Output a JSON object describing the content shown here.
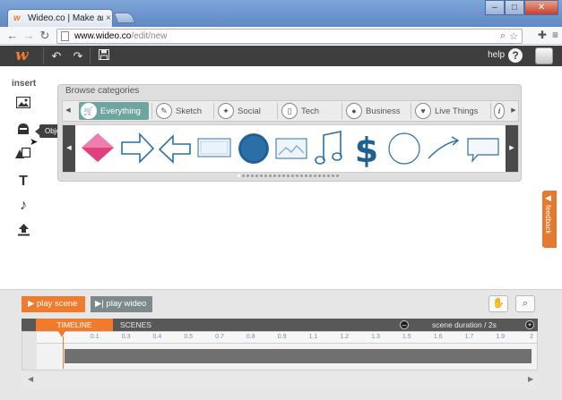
{
  "browser": {
    "tab_title": "Wideo.co | Make animated",
    "tab_close": "×",
    "favicon": "w",
    "url_host": "www.wideo.co",
    "url_path": "/edit/new",
    "window_controls": [
      "–",
      "□",
      "✕"
    ]
  },
  "app": {
    "logo": "w",
    "help_label": "help",
    "help_icon": "?"
  },
  "insert": {
    "label": "insert",
    "tools": [
      "image-icon",
      "objects-icon",
      "shapes-icon",
      "text-icon",
      "music-icon",
      "upload-icon"
    ],
    "tooltip": "Objects"
  },
  "browse": {
    "title": "Browse categories",
    "categories": [
      {
        "label": "Everything",
        "icon": "basket-icon",
        "active": true
      },
      {
        "label": "Sketch",
        "icon": "pencil-icon",
        "active": false
      },
      {
        "label": "Social",
        "icon": "twitter-icon",
        "active": false
      },
      {
        "label": "Tech",
        "icon": "phone-icon",
        "active": false
      },
      {
        "label": "Business",
        "icon": "piggy-bank-icon",
        "active": false
      },
      {
        "label": "Live Things",
        "icon": "heart-icon",
        "active": false
      },
      {
        "label": "",
        "icon": "info-icon",
        "active": false
      }
    ],
    "objects": [
      "pink-diamond",
      "right-arrow",
      "left-arrow",
      "screen",
      "blue-circle",
      "picture-frame",
      "music-note",
      "dollar-sign",
      "outline-circle",
      "curved-arrow",
      "speech-bubble"
    ],
    "page_count": 23,
    "active_page": 0
  },
  "feedback": {
    "label": "feedback"
  },
  "timeline": {
    "play_scene": "play scene",
    "play_video": "play wideo",
    "tab_timeline": "TIMELINE",
    "tab_scenes": "SCENES",
    "scene_duration": "scene duration / 2s",
    "ticks": [
      "0.1",
      "0.3",
      "0.4",
      "0.5",
      "0.7",
      "0.8",
      "0.9",
      "1.1",
      "1.2",
      "1.3",
      "1.5",
      "1.6",
      "1.7",
      "1.9",
      "2"
    ],
    "playhead_time": 0
  },
  "colors": {
    "accent": "#f07b2c",
    "app_bar": "#3e3e3e",
    "active_category": "#6fa5a0",
    "object_blue": "#2c6fa6",
    "object_pink": "#e0407f"
  }
}
